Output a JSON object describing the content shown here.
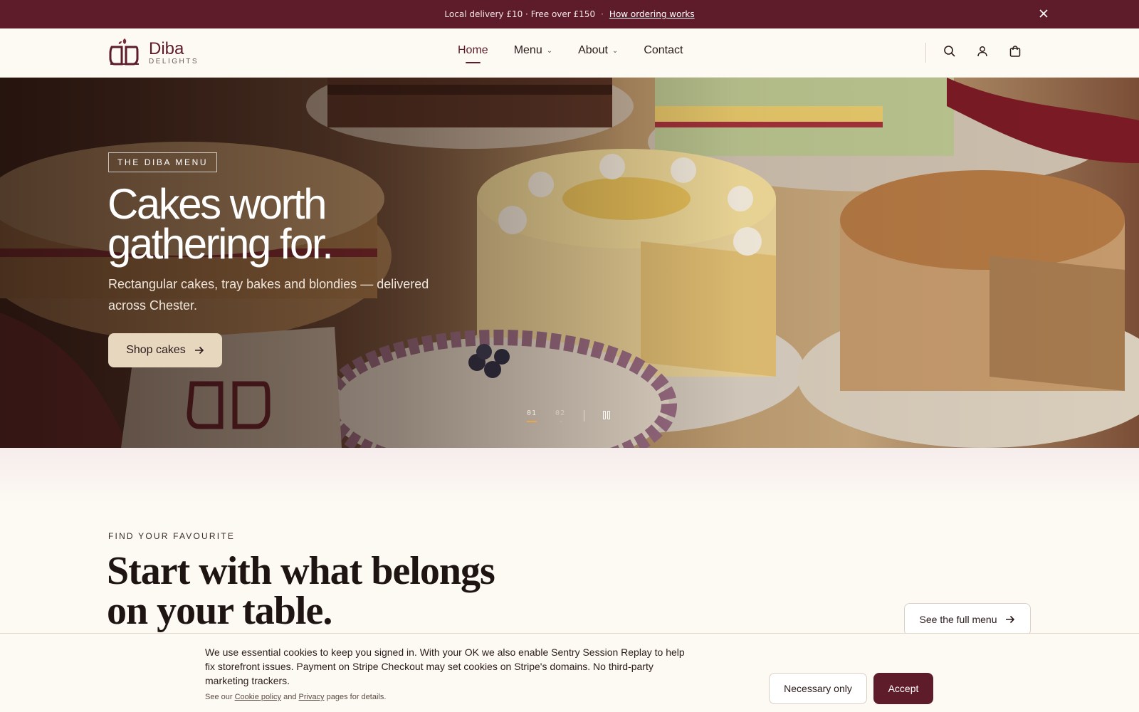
{
  "announcement": {
    "text": "Local delivery £10 · Free over £150",
    "link_label": "How ordering works",
    "close_icon": "close-icon"
  },
  "header": {
    "logo": {
      "name": "Diba",
      "sub": "DELIGHTS"
    },
    "nav": [
      {
        "label": "Home",
        "active": true
      },
      {
        "label": "Menu",
        "dropdown": true
      },
      {
        "label": "About",
        "dropdown": true
      },
      {
        "label": "Contact"
      }
    ],
    "icons": [
      "search-icon",
      "account-icon",
      "cart-icon"
    ]
  },
  "hero": {
    "tag": "THE DIBA MENU",
    "title": "Cakes worth gathering for.",
    "subtitle": "Rectangular cakes, tray bakes and blondies — delivered across Chester.",
    "cta_label": "Shop cakes",
    "slides": [
      "01",
      "02"
    ],
    "active_slide": 0
  },
  "section": {
    "eyebrow": "FIND YOUR FAVOURITE",
    "title": "Start with what belongs on your table.",
    "button_label": "See the full menu"
  },
  "cookie": {
    "text": "We use essential cookies to keep you signed in. With your OK we also enable Sentry Session Replay to help fix storefront issues. Payment on Stripe Checkout may set cookies on Stripe's domains. No third-party marketing trackers.",
    "small_prefix": "See our",
    "cookie_policy_label": "Cookie policy",
    "and": "and",
    "privacy_label": "Privacy",
    "small_suffix": "pages for details.",
    "necessary_label": "Necessary only",
    "accept_label": "Accept"
  },
  "colors": {
    "brand": "#5e1c2a",
    "accent_underline": "#e9a64a",
    "cta_bg": "#e8d7bf",
    "page_bg": "#fdfaf3"
  }
}
